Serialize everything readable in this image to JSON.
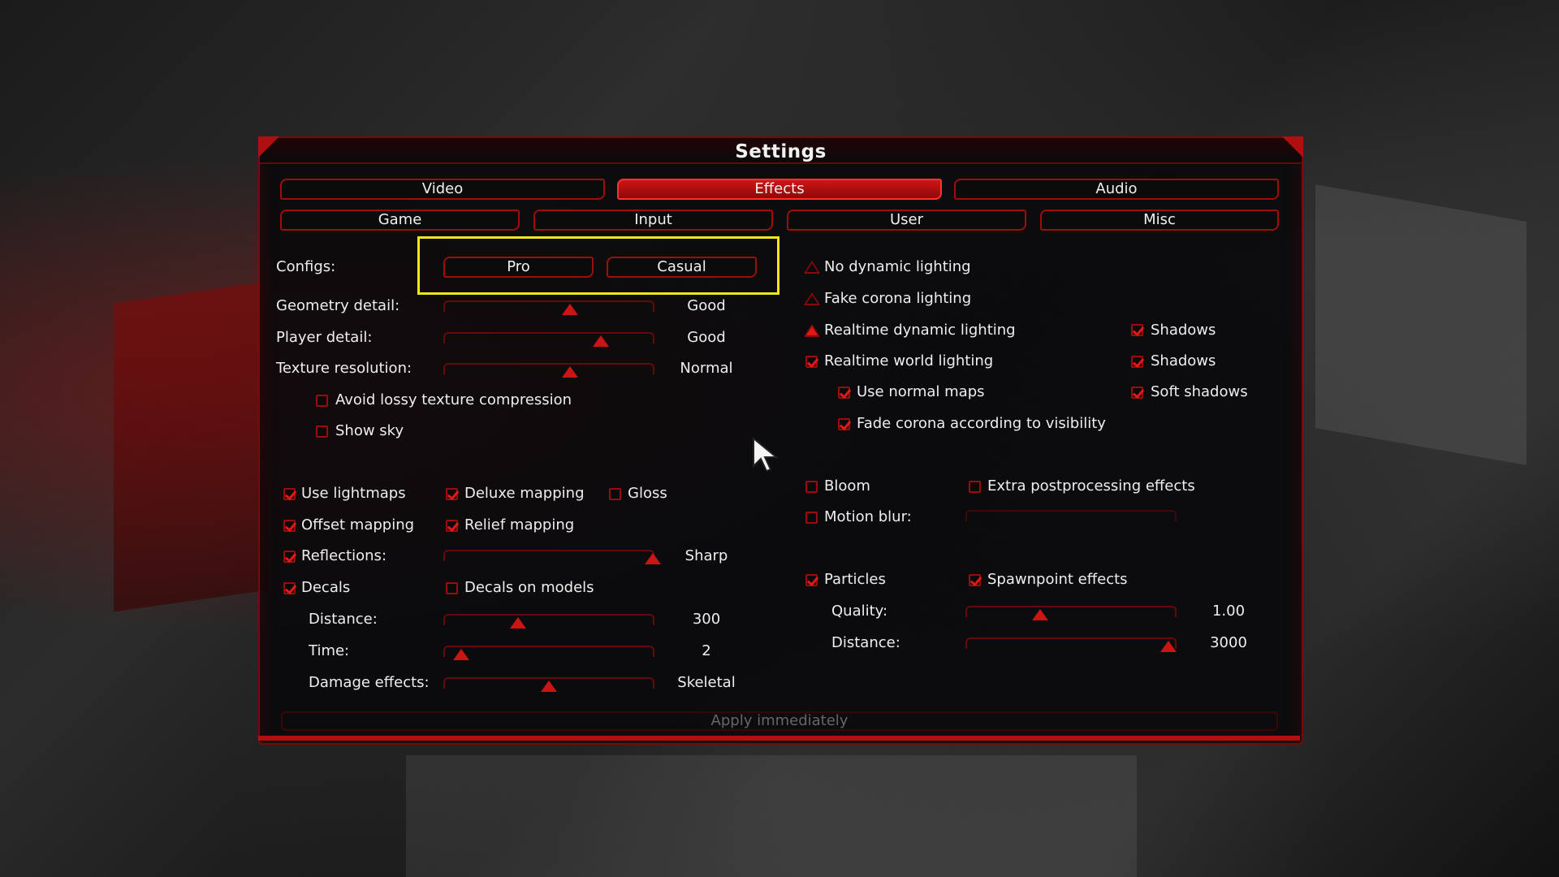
{
  "window": {
    "title": "Settings"
  },
  "tabs_row1": [
    {
      "label": "Video",
      "active": false
    },
    {
      "label": "Effects",
      "active": true
    },
    {
      "label": "Audio",
      "active": false
    }
  ],
  "tabs_row2": [
    {
      "label": "Game"
    },
    {
      "label": "Input"
    },
    {
      "label": "User"
    },
    {
      "label": "Misc"
    }
  ],
  "configs": {
    "label": "Configs:",
    "pro": "Pro",
    "casual": "Casual"
  },
  "left": {
    "geometry": {
      "label": "Geometry detail:",
      "value": "Good",
      "level": 0.6
    },
    "player": {
      "label": "Player detail:",
      "value": "Good",
      "level": 0.75
    },
    "texture": {
      "label": "Texture resolution:",
      "value": "Normal",
      "level": 0.6
    },
    "avoid_lossy": {
      "label": "Avoid lossy texture compression",
      "checked": false
    },
    "show_sky": {
      "label": "Show sky",
      "checked": false
    },
    "use_lightmaps": {
      "label": "Use lightmaps",
      "checked": true
    },
    "deluxe_mapping": {
      "label": "Deluxe mapping",
      "checked": true
    },
    "gloss": {
      "label": "Gloss",
      "checked": false
    },
    "offset_mapping": {
      "label": "Offset mapping",
      "checked": true
    },
    "relief_mapping": {
      "label": "Relief mapping",
      "checked": true
    },
    "reflections": {
      "label": "Reflections:",
      "value": "Sharp",
      "checked": true,
      "level": 1.0
    },
    "decals": {
      "label": "Decals",
      "checked": true
    },
    "decals_on_models": {
      "label": "Decals on models",
      "checked": false
    },
    "distance": {
      "label": "Distance:",
      "value": "300",
      "level": 0.35
    },
    "time": {
      "label": "Time:",
      "value": "2",
      "level": 0.08
    },
    "damage": {
      "label": "Damage effects:",
      "value": "Skeletal",
      "level": 0.5
    }
  },
  "right": {
    "no_dynamic": {
      "label": "No dynamic lighting",
      "selected": false
    },
    "fake_corona": {
      "label": "Fake corona lighting",
      "selected": false
    },
    "realtime_dynamic": {
      "label": "Realtime dynamic lighting",
      "selected": true
    },
    "shadows1": {
      "label": "Shadows",
      "checked": true
    },
    "realtime_world": {
      "label": "Realtime world lighting",
      "checked": true
    },
    "shadows2": {
      "label": "Shadows",
      "checked": true
    },
    "normal_maps": {
      "label": "Use normal maps",
      "checked": true
    },
    "soft_shadows": {
      "label": "Soft shadows",
      "checked": true
    },
    "fade_corona": {
      "label": "Fade corona according to visibility",
      "checked": true
    },
    "bloom": {
      "label": "Bloom",
      "checked": false
    },
    "extra_post": {
      "label": "Extra postprocessing effects",
      "checked": false
    },
    "motion_blur": {
      "label": "Motion blur:",
      "checked": false
    },
    "particles": {
      "label": "Particles",
      "checked": true
    },
    "spawnpoint": {
      "label": "Spawnpoint effects",
      "checked": true
    },
    "quality": {
      "label": "Quality:",
      "value": "1.00",
      "level": 0.35
    },
    "p_distance": {
      "label": "Distance:",
      "value": "3000",
      "level": 0.97
    }
  },
  "apply": {
    "label": "Apply immediately"
  },
  "colors": {
    "accent": "#e01515",
    "border": "#9c0c0c",
    "highlight": "#f0e816"
  }
}
